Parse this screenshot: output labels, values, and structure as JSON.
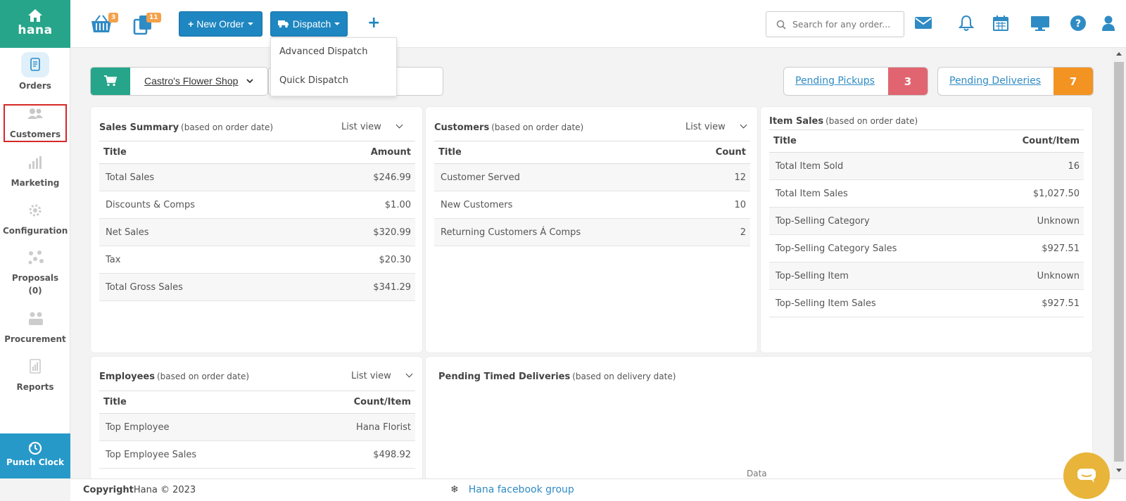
{
  "sidebar": {
    "brand": "hana",
    "items": [
      {
        "label": "Orders",
        "icon": "orders-icon"
      },
      {
        "label": "Customers",
        "icon": "customers-icon"
      },
      {
        "label": "Marketing",
        "icon": "marketing-icon"
      },
      {
        "label": "Configuration",
        "icon": "gear-icon"
      },
      {
        "label": "Proposals",
        "count": "(0)",
        "icon": "proposals-icon"
      },
      {
        "label": "Procurement",
        "icon": "procurement-icon"
      },
      {
        "label": "Reports",
        "icon": "reports-icon"
      }
    ],
    "punch_clock": "Punch Clock"
  },
  "topbar": {
    "basket_badge": "3",
    "orders_badge": "11",
    "new_order": "New Order",
    "dispatch": "Dispatch",
    "search_placeholder": "Search for any order..."
  },
  "dispatch_menu": {
    "items": [
      "Advanced Dispatch",
      "Quick Dispatch"
    ]
  },
  "filters": {
    "shop": "Castro's Flower Shop",
    "pending_pickups_label": "Pending Pickups",
    "pending_pickups_count": "3",
    "pending_deliveries_label": "Pending Deliveries",
    "pending_deliveries_count": "7"
  },
  "sales_summary": {
    "title": "Sales Summary",
    "subtitle": "(based on order date)",
    "view": "List view",
    "col_title": "Title",
    "col_value": "Amount",
    "rows": [
      {
        "title": "Total Sales",
        "value": "$246.99"
      },
      {
        "title": "Discounts & Comps",
        "value": "$1.00"
      },
      {
        "title": "Net Sales",
        "value": "$320.99"
      },
      {
        "title": "Tax",
        "value": "$20.30"
      },
      {
        "title": "Total Gross Sales",
        "value": "$341.29"
      }
    ]
  },
  "customers": {
    "title": "Customers",
    "subtitle": "(based on order date)",
    "view": "List view",
    "col_title": "Title",
    "col_value": "Count",
    "rows": [
      {
        "title": "Customer Served",
        "value": "12"
      },
      {
        "title": "New Customers",
        "value": "10"
      },
      {
        "title": "Returning Customers Á Comps",
        "value": "2"
      }
    ]
  },
  "item_sales": {
    "title": "Item Sales",
    "subtitle": "(based on order date)",
    "col_title": "Title",
    "col_value": "Count/Item",
    "rows": [
      {
        "title": "Total Item Sold",
        "value": "16"
      },
      {
        "title": "Total Item Sales",
        "value": "$1,027.50"
      },
      {
        "title": "Top-Selling Category",
        "value": "Unknown"
      },
      {
        "title": "Top-Selling Category Sales",
        "value": "$927.51"
      },
      {
        "title": "Top-Selling Item",
        "value": "Unknown"
      },
      {
        "title": "Top-Selling Item Sales",
        "value": "$927.51"
      }
    ]
  },
  "employees": {
    "title": "Employees",
    "subtitle": "(based on order date)",
    "view": "List view",
    "col_title": "Title",
    "col_value": "Count/Item",
    "rows": [
      {
        "title": "Top Employee",
        "value": "Hana Florist"
      },
      {
        "title": "Top Employee Sales",
        "value": "$498.92"
      }
    ]
  },
  "pending_timed": {
    "title": "Pending Timed Deliveries",
    "subtitle": "(based on delivery date)",
    "data_label": "Data"
  },
  "footer": {
    "copyright_bold": "Copyright",
    "copyright_rest": "Hana © 2023",
    "fb_link": "Hana facebook group"
  },
  "colors": {
    "brand_green": "#26a58a",
    "primary_blue": "#1e86c0",
    "pickup_red": "#e06570",
    "delivery_orange": "#f39322",
    "badge_orange": "#f4a14a",
    "chat_yellow": "#e8b43a"
  }
}
